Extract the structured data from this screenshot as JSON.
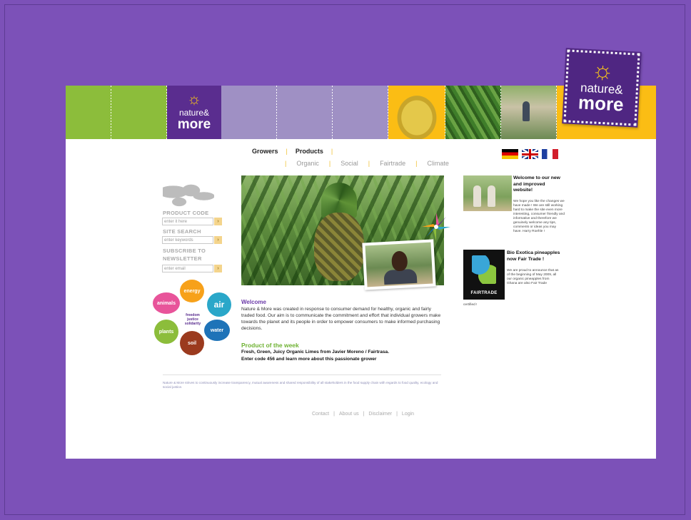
{
  "brand": {
    "line1": "nature&",
    "line2": "more",
    "sun_glyph": "☼",
    "colors": {
      "purple": "#5a2d8f",
      "green": "#8cbd3b",
      "lilac": "#9f90c4",
      "yellow": "#fbbd14",
      "background": "#7c51b8"
    }
  },
  "nav": {
    "primary": [
      "Growers",
      "Products"
    ],
    "secondary": [
      "Organic",
      "Social",
      "Fairtrade",
      "Climate"
    ],
    "separator": "|",
    "languages": [
      "German",
      "English",
      "French"
    ]
  },
  "sidebar": {
    "product_code_label": "PRODUCT CODE",
    "product_code_placeholder": "enter it here",
    "site_search_label": "SITE SEARCH",
    "site_search_placeholder": "enter keywords",
    "subscribe_label_1": "SUBSCRIBE TO",
    "subscribe_label_2": "NEWSLETTER",
    "subscribe_placeholder": "enter email",
    "go_glyph": "›",
    "flower": {
      "petals": [
        "energy",
        "air",
        "water",
        "soil",
        "plants",
        "animals"
      ],
      "center": "freedom justice solidarity"
    }
  },
  "main": {
    "welcome_title": "Welcome",
    "welcome_text": "Nature & More was created in response to consumer demand for healthy, organic and fairly traded food. Our aim is to communicate the commitment and effort that individual growers make towards the planet and its people in order to empower consumers to make informed purchasing decisions.",
    "potw_title": "Product of the week",
    "potw_line1": "Fresh, Green, Juicy Organic Limes from Javier Moreno / Fairtrasa.",
    "potw_line2": "Enter code 456 and learn more about this passionate grower"
  },
  "news": {
    "item1_title": "Welcome to our new and improved website!",
    "item1_text": "We hope you like the changes we have made ! We are still working hard to make the site even more interesting, consumer friendly and informative and therefore we genuinely welcome any tips, comments or ideas you may have. Harry Roehle !",
    "item2_title": "Bio Exotica pineapples now Fair Trade !",
    "item2_text": "We are proud to announce that as of the beginning of May 2009, all our organic pineapples from Ghana are also Fair Trade",
    "item2_tail": "certified !",
    "fairtrade_label": "FAIRTRADE"
  },
  "footer": {
    "text": "Nature & More strives to continuously increase transparency, mutual awareness and shared responsibility of all stakeholders in the food supply chain with regards to food quality, ecology and social justice.",
    "links": [
      "Contact",
      "About us",
      "Disclaimer",
      "Login"
    ],
    "separator": "|"
  }
}
